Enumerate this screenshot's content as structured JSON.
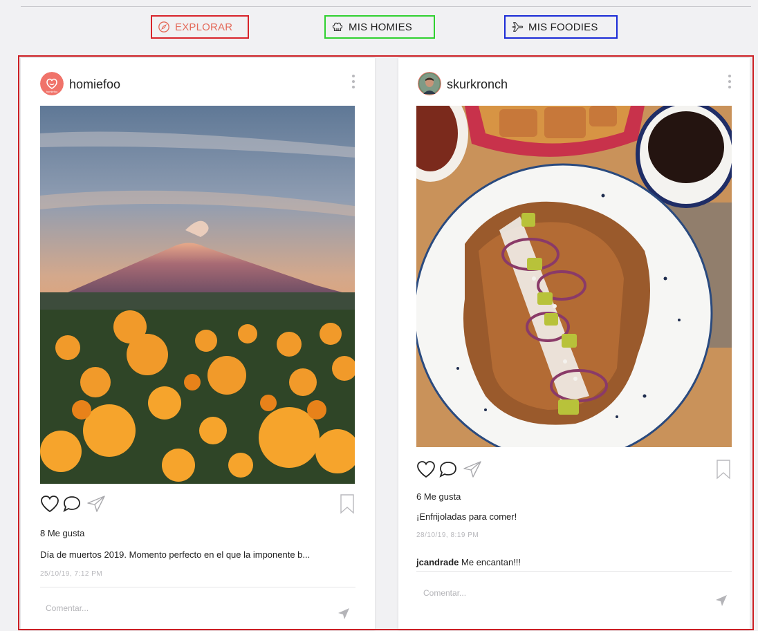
{
  "tabs": {
    "explorar": "EXPLORAR",
    "homies": "MIS HOMIES",
    "foodies": "MIS FOODIES"
  },
  "colors": {
    "accent": "#e46a5a",
    "frame_red": "#cc1f24",
    "frame_green": "#2fd12f",
    "frame_blue": "#1a2ad6"
  },
  "posts": [
    {
      "username": "homiefoo",
      "likes": "8 Me gusta",
      "caption": "Día de muertos 2019. Momento perfecto en el que la imponente b...",
      "timestamp": "25/10/19, 7:12 PM",
      "comment_placeholder": "Comentar..."
    },
    {
      "username": "skurkronch",
      "likes": "6 Me gusta",
      "caption": "¡Enfrijoladas para comer!",
      "timestamp": "28/10/19, 8:19 PM",
      "comment_user": "jcandrade",
      "comment_text": " Me encantan!!!",
      "comment_placeholder": "Comentar..."
    }
  ],
  "icons": [
    "compass-icon",
    "chef-hat-icon",
    "airplane-icon",
    "more-vertical-icon",
    "heart-icon",
    "comment-icon",
    "send-icon",
    "bookmark-icon"
  ]
}
